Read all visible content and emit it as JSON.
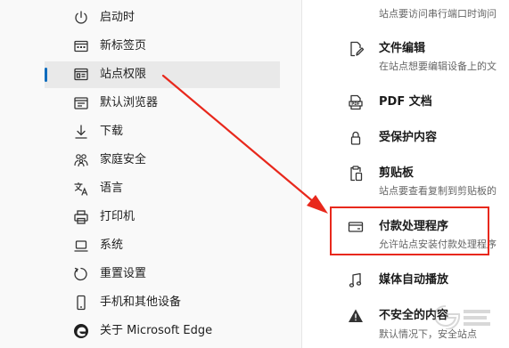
{
  "sidebar": {
    "items": [
      {
        "label": "启动时",
        "icon": "power-icon"
      },
      {
        "label": "新标签页",
        "icon": "new-tab-icon"
      },
      {
        "label": "站点权限",
        "icon": "site-permissions-icon",
        "selected": true
      },
      {
        "label": "默认浏览器",
        "icon": "default-browser-icon"
      },
      {
        "label": "下载",
        "icon": "download-icon"
      },
      {
        "label": "家庭安全",
        "icon": "family-icon"
      },
      {
        "label": "语言",
        "icon": "language-icon"
      },
      {
        "label": "打印机",
        "icon": "printer-icon"
      },
      {
        "label": "系统",
        "icon": "system-icon"
      },
      {
        "label": "重置设置",
        "icon": "reset-icon"
      },
      {
        "label": "手机和其他设备",
        "icon": "phone-icon"
      },
      {
        "label": "关于 Microsoft Edge",
        "icon": "edge-logo-icon"
      }
    ]
  },
  "permissions": {
    "items": [
      {
        "title": "",
        "desc": "站点要访问串行端口时询问",
        "icon": ""
      },
      {
        "title": "文件编辑",
        "desc": "在站点想要编辑设备上的文",
        "icon": "file-edit-icon"
      },
      {
        "title": "PDF 文档",
        "desc": "",
        "icon": "pdf-icon"
      },
      {
        "title": "受保护内容",
        "desc": "",
        "icon": "lock-icon"
      },
      {
        "title": "剪贴板",
        "desc": "站点要查看复制到剪贴板的",
        "icon": "clipboard-icon"
      },
      {
        "title": "付款处理程序",
        "desc": "允许站点安装付款处理程序",
        "icon": "payment-icon"
      },
      {
        "title": "媒体自动播放",
        "desc": "",
        "icon": "music-icon"
      },
      {
        "title": "不安全的内容",
        "desc": "默认情况下，安全站点",
        "icon": "warning-icon"
      }
    ]
  },
  "annotation": {
    "color": "#e8281c"
  },
  "colors": {
    "accent": "#0f6cbd",
    "selected_bg": "#e9e9e9",
    "highlight_border": "#e8281c"
  }
}
